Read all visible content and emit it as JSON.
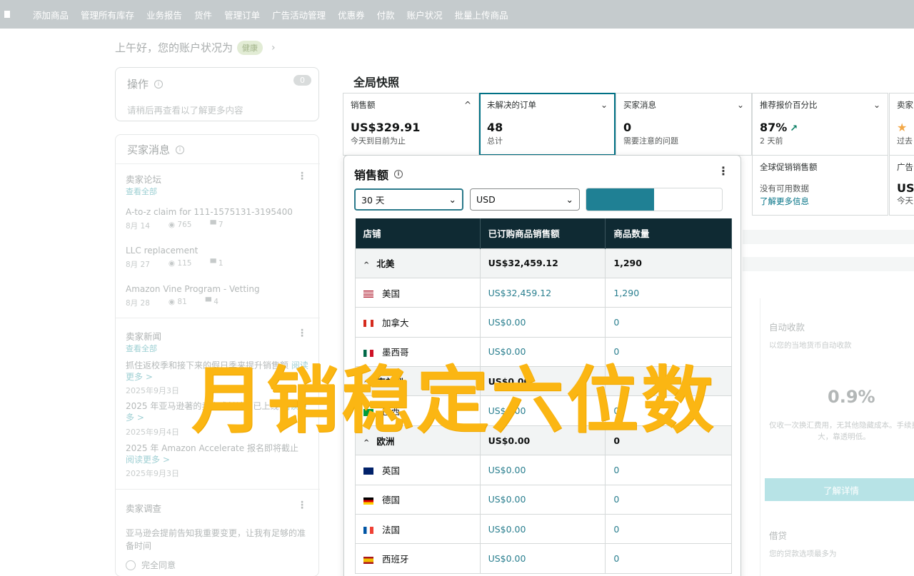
{
  "topnav": {
    "items": [
      "添加商品",
      "管理所有库存",
      "业务报告",
      "货件",
      "管理订单",
      "广告活动管理",
      "优惠券",
      "付款",
      "账户状况",
      "批量上传商品"
    ]
  },
  "greeting": {
    "text": "上午好，您的账户状况为",
    "badge": "健康",
    "chevron": "›"
  },
  "ops": {
    "title": "操作",
    "count": "0",
    "desc": "请稍后再查看以了解更多内容"
  },
  "messages": {
    "title": "买家消息",
    "forum": {
      "head": "卖家论坛",
      "link": "查看全部",
      "threads": [
        {
          "title": "A-to-z claim for 111-1575131-3195400",
          "date": "8月 14",
          "views": "765",
          "replies": "7"
        },
        {
          "title": "LLC replacement",
          "date": "8月 27",
          "views": "115",
          "replies": "1"
        },
        {
          "title": "Amazon Vine Program - Vetting",
          "date": "8月 28",
          "views": "81",
          "replies": "4"
        }
      ]
    },
    "news": {
      "head": "卖家新闻",
      "link": "查看全部",
      "items": [
        {
          "title": "抓住返校季和接下来的假日季来提升销售额",
          "more": "阅读更多 >",
          "date": "2025年9月3日"
        },
        {
          "title": "2025 年亚马逊著的卖家成长计划已上线",
          "more": "阅读更多 >",
          "date": "2025年9月4日"
        },
        {
          "title": "2025 年 Amazon Accelerate 报名即将截止",
          "more": "阅读更多 >",
          "date": "2025年9月3日"
        }
      ]
    },
    "survey": {
      "head": "卖家调查",
      "question": "亚马逊会提前告知我重要变更，让我有足够的准备时间",
      "option": "完全同意"
    }
  },
  "snapshot": {
    "title": "全局快照",
    "tiles": [
      {
        "title": "销售额",
        "value": "US$329.91",
        "sub": "今天到目前为止",
        "caret": "^"
      },
      {
        "title": "未解决的订单",
        "value": "48",
        "sub": "总计",
        "caret": "⌄"
      },
      {
        "title": "买家消息",
        "value": "0",
        "sub": "需要注意的问题",
        "caret": "⌄"
      },
      {
        "title": "推荐报价百分比",
        "value": "87%",
        "sub": "2 天前",
        "caret": "⌄"
      },
      {
        "title": "卖家",
        "value": "★",
        "sub": "过去"
      }
    ],
    "tiles2": [
      {
        "title": "全球促销销售额",
        "sub": "没有可用数据",
        "link": "了解更多信息"
      },
      {
        "title": "广告",
        "value": "US",
        "sub": "今天"
      }
    ]
  },
  "right_panel": {
    "title": "自动收款",
    "sub": "以您的当地货币自动收款",
    "pct": "0.9%",
    "desc": "仅收一次换汇费用，无其他隐藏成本。手续费大，靠透明低。",
    "button": "了解详情",
    "loan_title": "借贷",
    "loan_sub": "您的贷款选项最多为"
  },
  "popup": {
    "title": "销售额",
    "period": "30 天",
    "currency": "USD",
    "columns": [
      "店铺",
      "已订购商品销售额",
      "商品数量"
    ],
    "rows": [
      {
        "type": "region",
        "name": "北美",
        "sales": "US$32,459.12",
        "qty": "1,290"
      },
      {
        "type": "store",
        "flag": "us",
        "name": "美国",
        "sales": "US$32,459.12",
        "qty": "1,290"
      },
      {
        "type": "store",
        "flag": "ca",
        "name": "加拿大",
        "sales": "US$0.00",
        "qty": "0"
      },
      {
        "type": "store",
        "flag": "mx",
        "name": "墨西哥",
        "sales": "US$0.00",
        "qty": "0"
      },
      {
        "type": "region",
        "name": "南美洲",
        "sales": "US$0.00",
        "qty": "0"
      },
      {
        "type": "store",
        "flag": "br",
        "name": "巴西",
        "sales": "US$0.00",
        "qty": "0"
      },
      {
        "type": "region",
        "name": "欧洲",
        "sales": "US$0.00",
        "qty": "0"
      },
      {
        "type": "store",
        "flag": "gb",
        "name": "英国",
        "sales": "US$0.00",
        "qty": "0"
      },
      {
        "type": "store",
        "flag": "de",
        "name": "德国",
        "sales": "US$0.00",
        "qty": "0"
      },
      {
        "type": "store",
        "flag": "fr",
        "name": "法国",
        "sales": "US$0.00",
        "qty": "0"
      },
      {
        "type": "store",
        "flag": "es",
        "name": "西班牙",
        "sales": "US$0.00",
        "qty": "0"
      }
    ]
  },
  "overlay": {
    "text": "月销稳定六位数"
  },
  "colors": {
    "accent": "#007185",
    "header_bg": "#0f2a33",
    "overlay": "#fbb613",
    "nav_bg": "#c5cbcd"
  }
}
